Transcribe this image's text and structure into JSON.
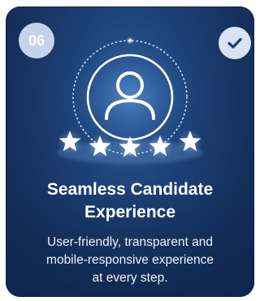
{
  "card": {
    "step_number": "06",
    "title_line1": "Seamless Candidate",
    "title_line2": "Experience",
    "description_line1": "User-friendly, transparent and",
    "description_line2": "mobile-responsive experience",
    "description_line3": "at every step.",
    "rating_stars": 5,
    "icons": {
      "completed": "check-icon",
      "person": "user-icon",
      "rating": "star-icon"
    },
    "colors": {
      "card_background": "#1c3f73",
      "badge": "#c4d3ec",
      "text": "#ffffff"
    }
  }
}
